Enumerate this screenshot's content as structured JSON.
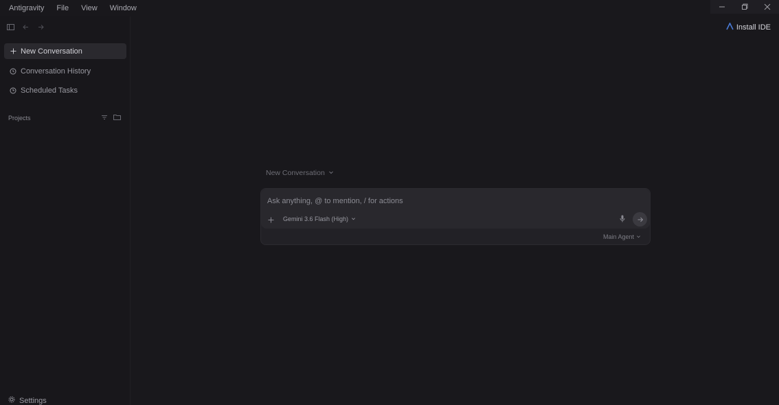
{
  "menubar": {
    "items": [
      "Antigravity",
      "File",
      "View",
      "Window"
    ]
  },
  "window_controls": {
    "minimize_icon": "minimize-icon",
    "restore_icon": "restore-icon",
    "close_icon": "close-icon"
  },
  "sidebar": {
    "nav": [
      {
        "label": "New Conversation",
        "icon": "plus-icon",
        "active": true
      },
      {
        "label": "Conversation History",
        "icon": "history-icon",
        "active": false
      },
      {
        "label": "Scheduled Tasks",
        "icon": "clock-icon",
        "active": false
      }
    ],
    "projects_label": "Projects",
    "settings_label": "Settings"
  },
  "header": {
    "install_label": "Install IDE"
  },
  "composer": {
    "conversation_label": "New Conversation",
    "placeholder": "Ask anything, @ to mention, / for actions",
    "model_label": "Gemini 3.6 Flash (High)",
    "agent_label": "Main Agent"
  },
  "colors": {
    "background": "#19181c",
    "sidebar": "#18171b",
    "accent": "#4a7bd8",
    "composer": "#29282d"
  }
}
